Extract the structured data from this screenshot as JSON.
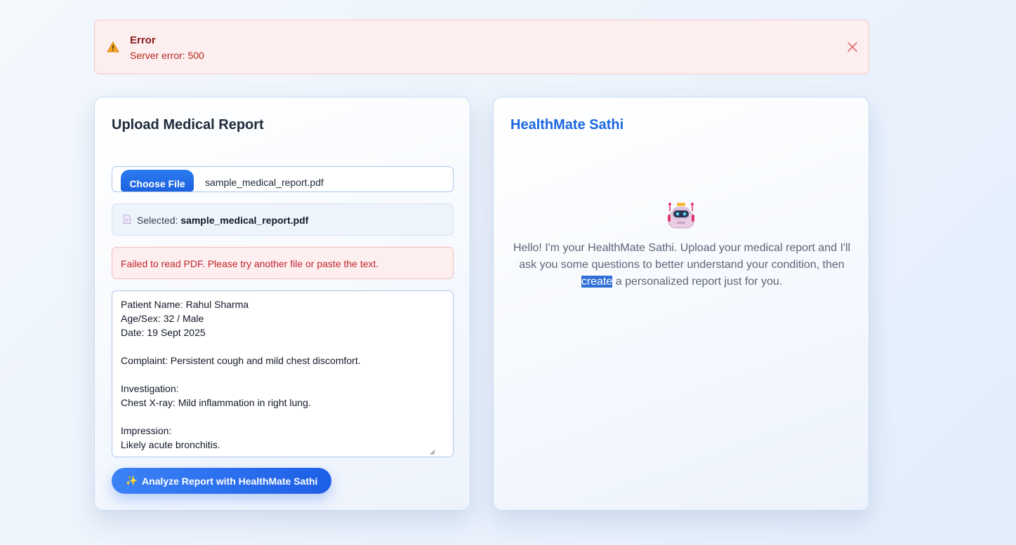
{
  "error_banner": {
    "title": "Error",
    "message": "Server error: 500",
    "icon": "warning-icon",
    "close_icon": "close-icon"
  },
  "upload_panel": {
    "title": "Upload Medical Report",
    "choose_file_label": "Choose File",
    "file_name": "sample_medical_report.pdf",
    "selected_prefix": "Selected:",
    "selected_file": "sample_medical_report.pdf",
    "pdf_error": "Failed to read PDF. Please try another file or paste the text.",
    "report_text": "Patient Name: Rahul Sharma\nAge/Sex: 32 / Male\nDate: 19 Sept 2025\n\nComplaint: Persistent cough and mild chest discomfort.\n\nInvestigation:\nChest X-ray: Mild inflammation in right lung.\n\nImpression:\nLikely acute bronchitis.",
    "analyze_button": "Analyze Report with HealthMate Sathi",
    "analyze_icon": "sparkles-icon"
  },
  "chat_panel": {
    "title": "HealthMate Sathi",
    "avatar": "robot-icon",
    "welcome_part1": "Hello! I'm your HealthMate Sathi. Upload your medical report and I'll ask you some questions to better understand your condition, then ",
    "welcome_highlight": "create",
    "welcome_part2": " a personalized report just for you."
  },
  "colors": {
    "accent": "#1a66e0",
    "error_bg": "#fdefef",
    "error_text": "#b3261e"
  }
}
